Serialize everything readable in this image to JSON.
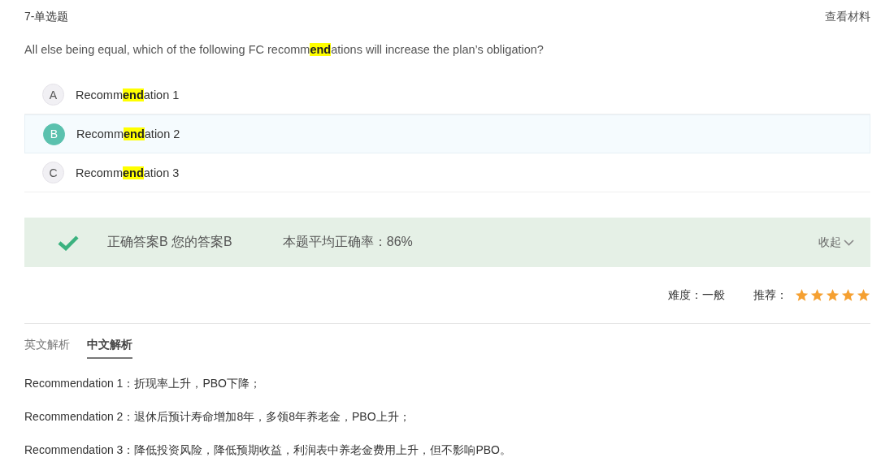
{
  "header": {
    "title": "7-单选题",
    "link": "查看材料"
  },
  "question": [
    {
      "text": "All else being equal, which of the following FC recomm",
      "highlighted": false
    },
    {
      "text": "end",
      "highlighted": true
    },
    {
      "text": "ations will increase the plan’s obligation?",
      "highlighted": false
    }
  ],
  "options": [
    {
      "letter": "A",
      "selected": false,
      "parts": [
        {
          "text": "Recomm",
          "highlighted": false
        },
        {
          "text": "end",
          "highlighted": true
        },
        {
          "text": "ation 1",
          "highlighted": false
        }
      ]
    },
    {
      "letter": "B",
      "selected": true,
      "parts": [
        {
          "text": "Recomm",
          "highlighted": false
        },
        {
          "text": "end",
          "highlighted": true
        },
        {
          "text": "ation 2",
          "highlighted": false
        }
      ]
    },
    {
      "letter": "C",
      "selected": false,
      "parts": [
        {
          "text": "Recomm",
          "highlighted": false
        },
        {
          "text": "end",
          "highlighted": true
        },
        {
          "text": "ation 3",
          "highlighted": false
        }
      ]
    }
  ],
  "result": {
    "correct": true,
    "answer_text": "正确答案B 您的答案B",
    "accuracy_text": "本题平均正确率：86%",
    "collapse": "收起"
  },
  "rating": {
    "difficulty_label": "难度：一般",
    "recommend_label": "推荐：",
    "stars": 5
  },
  "tabs": [
    {
      "label": "英文解析",
      "selected": false
    },
    {
      "label": "中文解析",
      "selected": true
    }
  ],
  "explanations": [
    "Recommendation 1：折现率上升，PBO下降；",
    "Recommendation 2：退休后预计寿命增加8年，多领8年养老金，PBO上升；",
    "Recommendation 3：降低投资风险，降低预期收益，利润表中养老金费用上升，但不影响PBO。"
  ]
}
